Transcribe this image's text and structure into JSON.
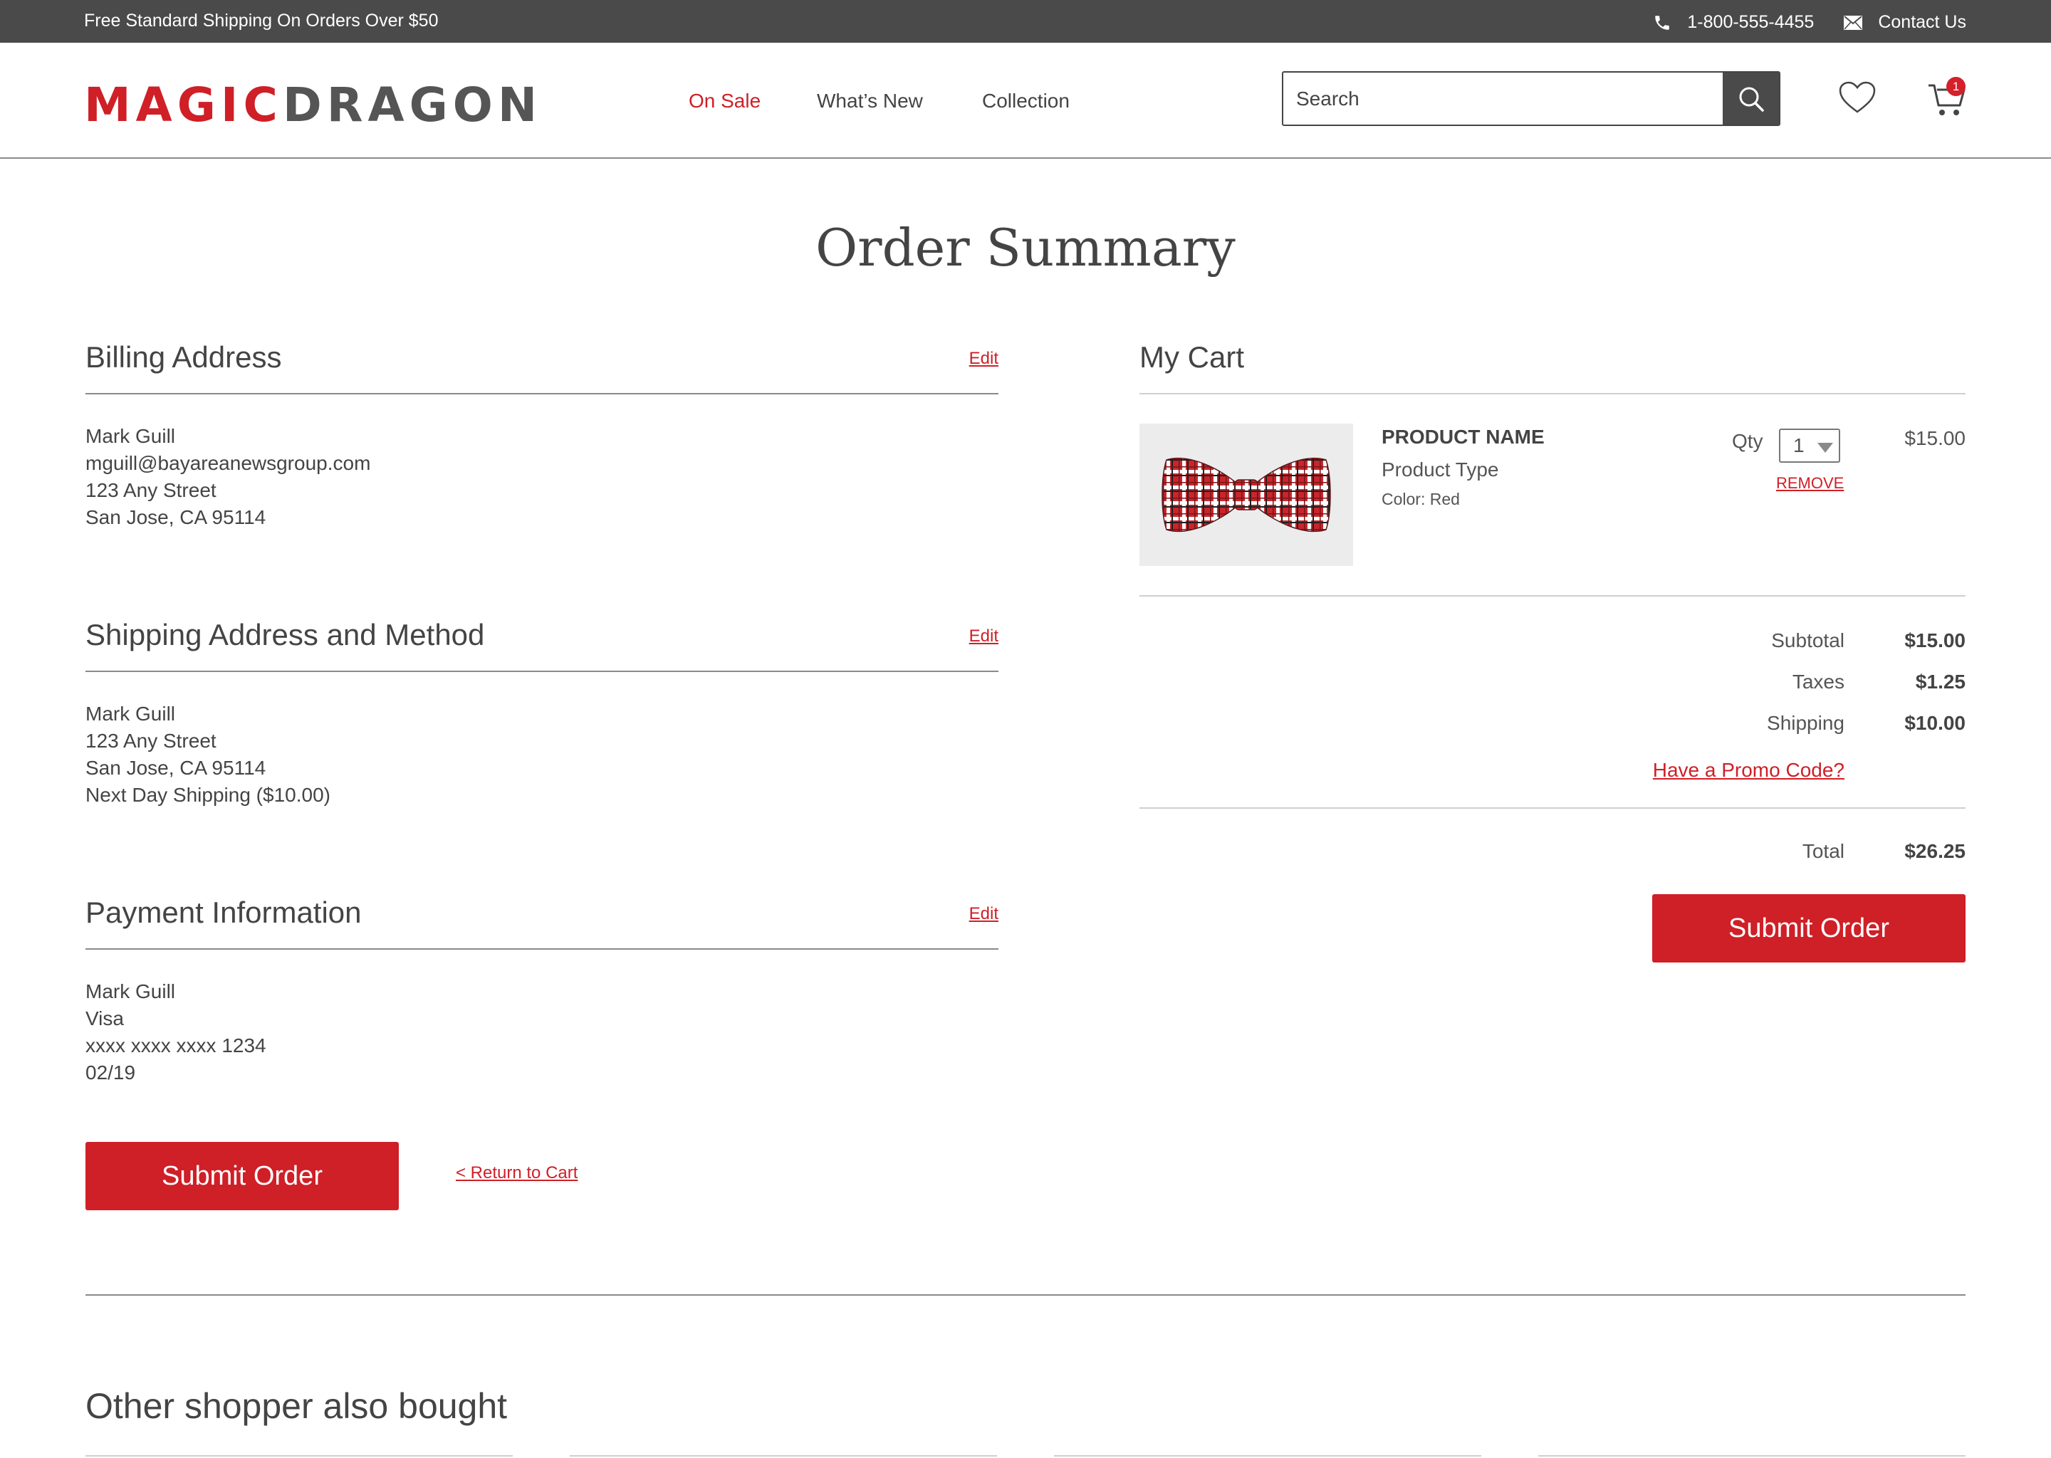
{
  "topbar": {
    "promo_text": "Free Standard Shipping On Orders Over $50",
    "phone": "1-800-555-4455",
    "contact_label": "Contact Us"
  },
  "header": {
    "logo_part1": "MAGIC",
    "logo_part2": "DRAGON",
    "nav": [
      "On Sale",
      "What’s New",
      "Collection"
    ],
    "search_placeholder": "Search",
    "cart_count": "1"
  },
  "page": {
    "title": "Order Summary"
  },
  "billing": {
    "heading": "Billing Address",
    "edit_label": "Edit",
    "lines": [
      "Mark Guill",
      "mguill@bayareanewsgroup.com",
      "123 Any Street",
      "San Jose, CA 95114"
    ]
  },
  "shipping": {
    "heading": "Shipping Address and Method",
    "edit_label": "Edit",
    "lines": [
      "Mark Guill",
      "123 Any Street",
      "San Jose, CA 95114",
      "Next Day Shipping ($10.00)"
    ]
  },
  "payment": {
    "heading": "Payment Information",
    "edit_label": "Edit",
    "lines": [
      "Mark Guill",
      "Visa",
      "xxxx xxxx xxxx 1234",
      "02/19"
    ]
  },
  "actions": {
    "submit_label": "Submit Order",
    "return_label": "< Return to Cart"
  },
  "cart": {
    "heading": "My Cart",
    "item": {
      "name": "PRODUCT NAME",
      "type": "Product Type",
      "color": "Color: Red",
      "qty_label": "Qty",
      "qty_value": "1",
      "remove_label": "REMOVE",
      "price": "$15.00"
    },
    "summary": {
      "subtotal_label": "Subtotal",
      "subtotal_value": "$15.00",
      "taxes_label": "Taxes",
      "taxes_value": "$1.25",
      "shipping_label": "Shipping",
      "shipping_value": "$10.00",
      "promo_label": "Have a Promo Code?",
      "total_label": "Total",
      "total_value": "$26.25"
    }
  },
  "other": {
    "heading": "Other shopper also bought"
  },
  "colors": {
    "accent": "#cf1f27",
    "topbar": "#4a4a4a",
    "text": "#444444"
  }
}
